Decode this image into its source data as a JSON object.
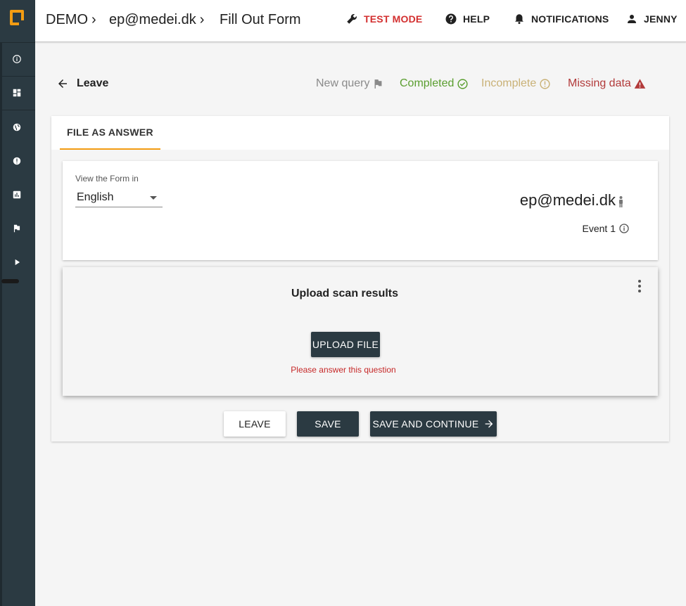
{
  "header": {
    "breadcrumbs": [
      {
        "label": "DEMO",
        "sep": "›"
      },
      {
        "label": "ep@medei.dk",
        "sep": "›"
      },
      {
        "label": "Fill Out Form"
      }
    ],
    "test_mode": "TEST MODE",
    "help": "HELP",
    "notifications": "NOTIFICATIONS",
    "user": "JENNY"
  },
  "sidebar": {
    "icons": [
      "info-icon",
      "dashboard-icon",
      "globe-icon",
      "alert-icon",
      "chart-icon",
      "flag-icon",
      "play-icon"
    ]
  },
  "form_header": {
    "back_label": "Leave",
    "statuses": [
      {
        "label": "New query",
        "icon": "flag-icon",
        "color": "#8a8a8a"
      },
      {
        "label": "Completed",
        "icon": "check-circle-icon",
        "color": "#5a9e2f"
      },
      {
        "label": "Incomplete",
        "icon": "exclamation-circle-icon",
        "color": "#c9b176"
      },
      {
        "label": "Missing data",
        "icon": "warning-icon",
        "color": "#b23a3a"
      }
    ]
  },
  "tab": {
    "label": "FILE AS ANSWER"
  },
  "language": {
    "label": "View the Form in",
    "selected": "English"
  },
  "subject": {
    "id": "ep@medei.dk",
    "event": "Event 1"
  },
  "question": {
    "title": "Upload scan results",
    "upload_label": "UPLOAD FILE",
    "error": "Please answer this question"
  },
  "actions": {
    "leave": "LEAVE",
    "save": "SAVE",
    "save_continue": "SAVE AND CONTINUE"
  },
  "colors": {
    "accent": "#f39c12",
    "dark": "#2b3a42",
    "test_mode": "#d32f2f",
    "error": "#c62828"
  }
}
